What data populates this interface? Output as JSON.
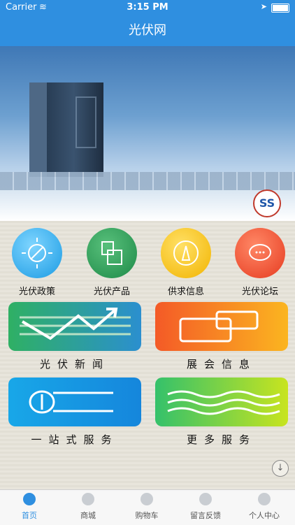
{
  "status_bar": {
    "carrier": "Carrier",
    "time": "3:15 PM"
  },
  "nav": {
    "title": "光伏网"
  },
  "banner": {
    "logo_glyph": "SS"
  },
  "quick_menu": [
    {
      "label": "光伏政策",
      "icon": "sun-icon"
    },
    {
      "label": "光伏产品",
      "icon": "solar-panel-icon"
    },
    {
      "label": "供求信息",
      "icon": "lightbulb-icon"
    },
    {
      "label": "光伏论坛",
      "icon": "chat-bubble-icon"
    }
  ],
  "cards": [
    {
      "label": "光伏新闻",
      "icon": "trend-chart-icon"
    },
    {
      "label": "展会信息",
      "icon": "linked-boxes-icon"
    },
    {
      "label": "一站式服务",
      "icon": "shield-lines-icon"
    },
    {
      "label": "更多服务",
      "icon": "waves-icon"
    }
  ],
  "tabs": [
    {
      "label": "首页",
      "icon": "home-icon",
      "active": true
    },
    {
      "label": "商城",
      "icon": "store-icon",
      "active": false
    },
    {
      "label": "购物车",
      "icon": "cart-icon",
      "active": false
    },
    {
      "label": "留言反馈",
      "icon": "message-icon",
      "active": false
    },
    {
      "label": "个人中心",
      "icon": "user-icon",
      "active": false
    }
  ],
  "colors": {
    "primary": "#2f8fe0"
  }
}
